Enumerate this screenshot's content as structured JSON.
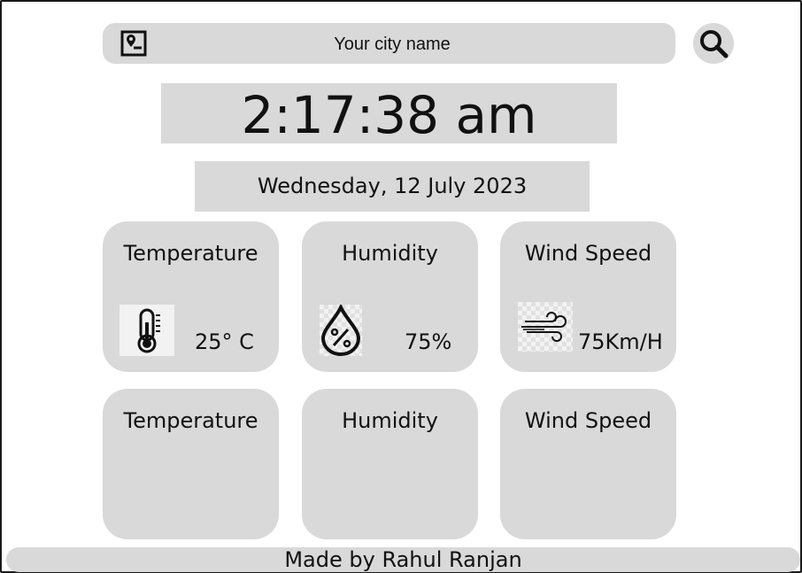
{
  "search": {
    "placeholder": "Your city name",
    "location_icon": "map-pin-icon",
    "search_icon": "search-icon"
  },
  "clock": {
    "time": "2:17:38 am",
    "date": "Wednesday, 12 July 2023"
  },
  "cards_top": [
    {
      "title": "Temperature",
      "value": "25° C",
      "icon": "thermometer-icon"
    },
    {
      "title": "Humidity",
      "value": "75%",
      "icon": "humidity-drop-icon"
    },
    {
      "title": "Wind Speed",
      "value": "75Km/H",
      "icon": "wind-icon"
    }
  ],
  "cards_bottom": [
    {
      "title": "Temperature"
    },
    {
      "title": "Humidity"
    },
    {
      "title": "Wind Speed"
    }
  ],
  "footer": {
    "text": "Made by Rahul Ranjan"
  },
  "colors": {
    "panel": "#d9d9d9",
    "text": "#111111",
    "background": "#ffffff"
  }
}
